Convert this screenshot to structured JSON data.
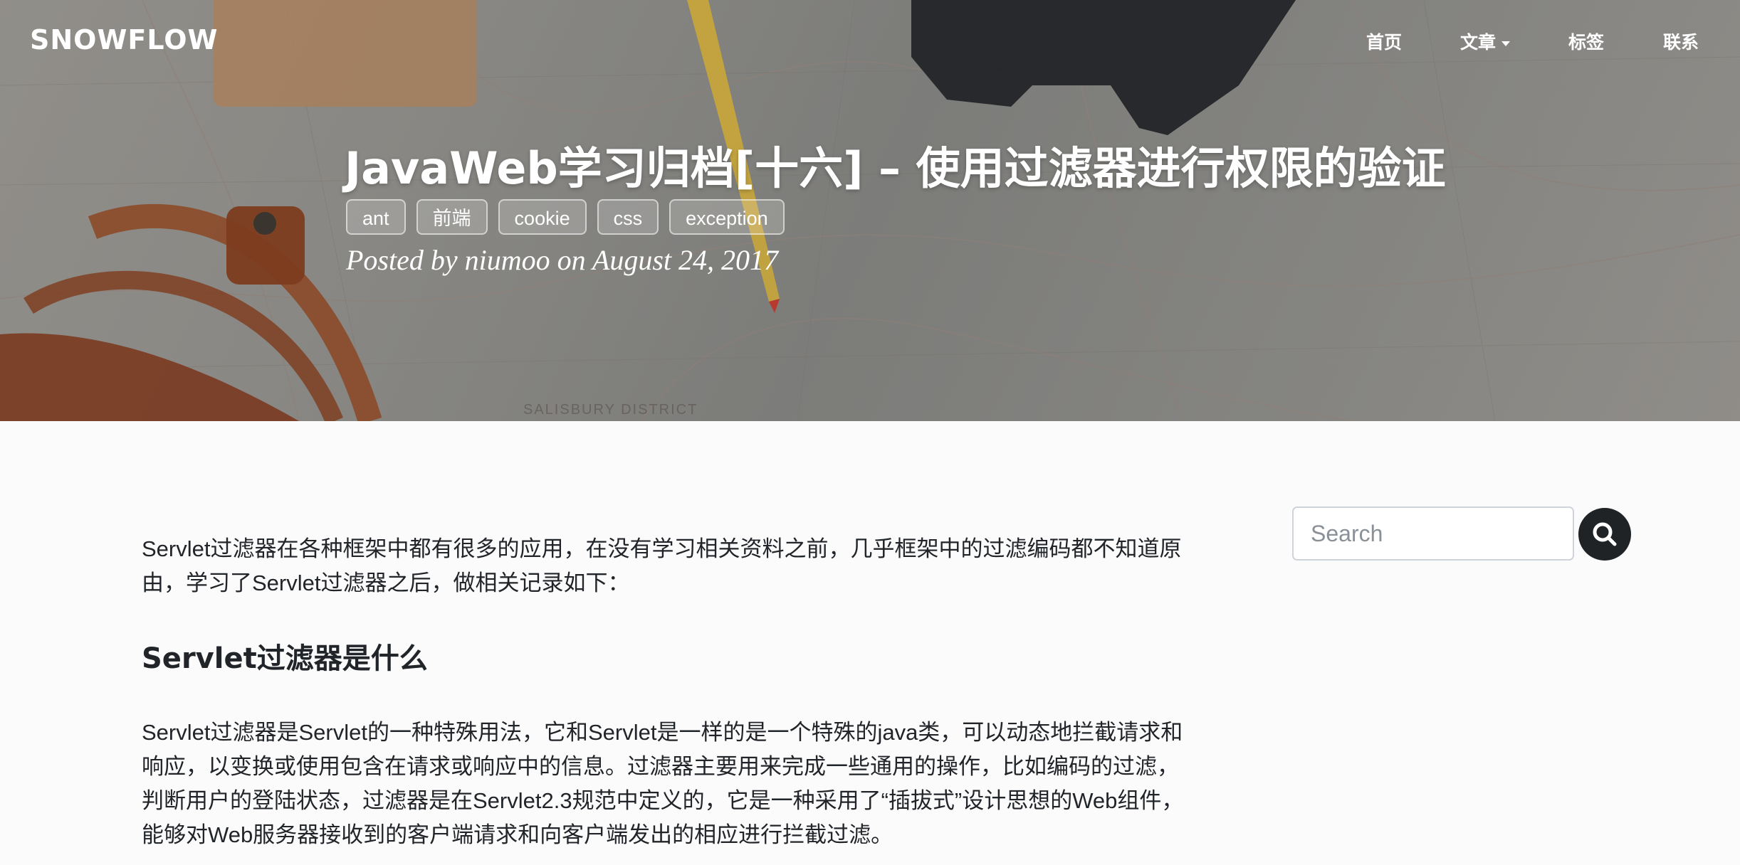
{
  "navbar": {
    "brand": "SNOWFLOW",
    "items": [
      {
        "label": "首页"
      },
      {
        "label": "文章"
      },
      {
        "label": "标签"
      },
      {
        "label": "联系"
      }
    ]
  },
  "header": {
    "title": "JavaWeb学习归档[十六] – 使用过滤器进行权限的验证",
    "tags": [
      "ant",
      "前端",
      "cookie",
      "css",
      "exception"
    ],
    "meta": "Posted by niumoo on August 24, 2017",
    "map_text": [
      "SALISBURY DISTRICT"
    ]
  },
  "article": {
    "intro": "Servlet过滤器在各种框架中都有很多的应用，在没有学习相关资料之前，几乎框架中的过滤编码都不知道原由，学习了Servlet过滤器之后，做相关记录如下：",
    "heading": "Servlet过滤器是什么",
    "body": "Servlet过滤器是Servlet的一种特殊用法，它和Servlet是一样的是一个特殊的java类，可以动态地拦截请求和响应，以变换或使用包含在请求或响应中的信息。过滤器主要用来完成一些通用的操作，比如编码的过滤，判断用户的登陆状态，过滤器是在Servlet2.3规范中定义的，它是一种采用了“插拔式”设计思想的Web组件，能够对Web服务器接收到的客户端请求和向客户端发出的相应进行拦截过滤。"
  },
  "sidebar": {
    "search": {
      "placeholder": "Search",
      "value": "",
      "icon": "search-icon"
    }
  },
  "colors": {
    "search_button": "#1f2326",
    "text": "#212529",
    "page_bg": "#fbfbfb"
  }
}
